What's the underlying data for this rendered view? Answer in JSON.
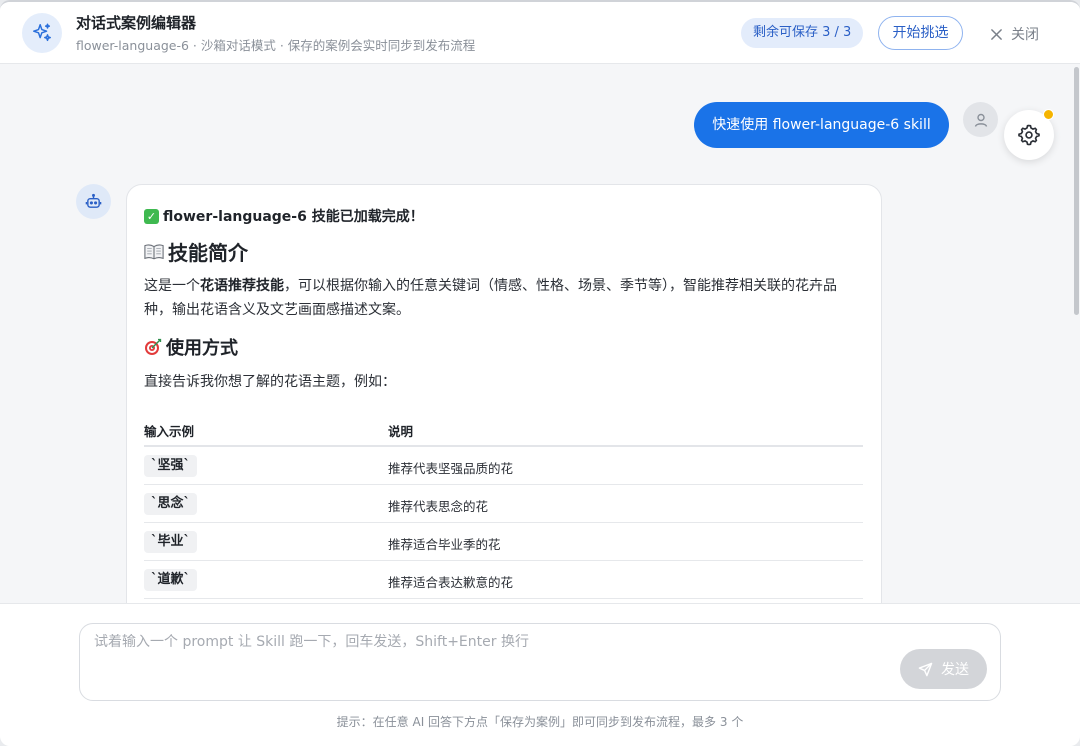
{
  "header": {
    "title": "对话式案例编辑器",
    "subtitle": "flower-language-6 · 沙箱对话模式 · 保存的案例会实时同步到发布流程",
    "quota_label": "剩余可保存 3 / 3",
    "start_label": "开始挑选",
    "close_label": "关闭"
  },
  "chat": {
    "user_message": "快速使用 flower-language-6 skill",
    "bot": {
      "load_text": "flower-language-6 技能已加载完成！",
      "intro_heading": "技能简介",
      "intro_pre": "这是一个",
      "intro_bold": "花语推荐技能",
      "intro_post": "，可以根据你输入的任意关键词（情感、性格、场景、季节等），智能推荐相关联的花卉品种，输出花语含义及文艺画面感描述文案。",
      "usage_heading": "使用方式",
      "usage_text": "直接告诉我你想了解的花语主题，例如：",
      "table": {
        "headers": [
          "输入示例",
          "说明"
        ],
        "rows": [
          {
            "example": "`坚强`",
            "desc": "推荐代表坚强品质的花"
          },
          {
            "example": "`思念`",
            "desc": "推荐代表思念的花"
          },
          {
            "example": "`毕业`",
            "desc": "推荐适合毕业季的花"
          },
          {
            "example": "`道歉`",
            "desc": "推荐适合表达歉意的花"
          }
        ]
      }
    }
  },
  "composer": {
    "placeholder": "试着输入一个 prompt 让 Skill 跑一下，回车发送，Shift+Enter 换行",
    "value": "",
    "send_label": "发送",
    "hint": "提示：在任意 AI 回答下方点「保存为案例」即可同步到发布流程，最多 3 个"
  },
  "colors": {
    "accent": "#1a73e8",
    "badge_bg": "#e3ecfb",
    "notification_dot": "#f5b400"
  }
}
